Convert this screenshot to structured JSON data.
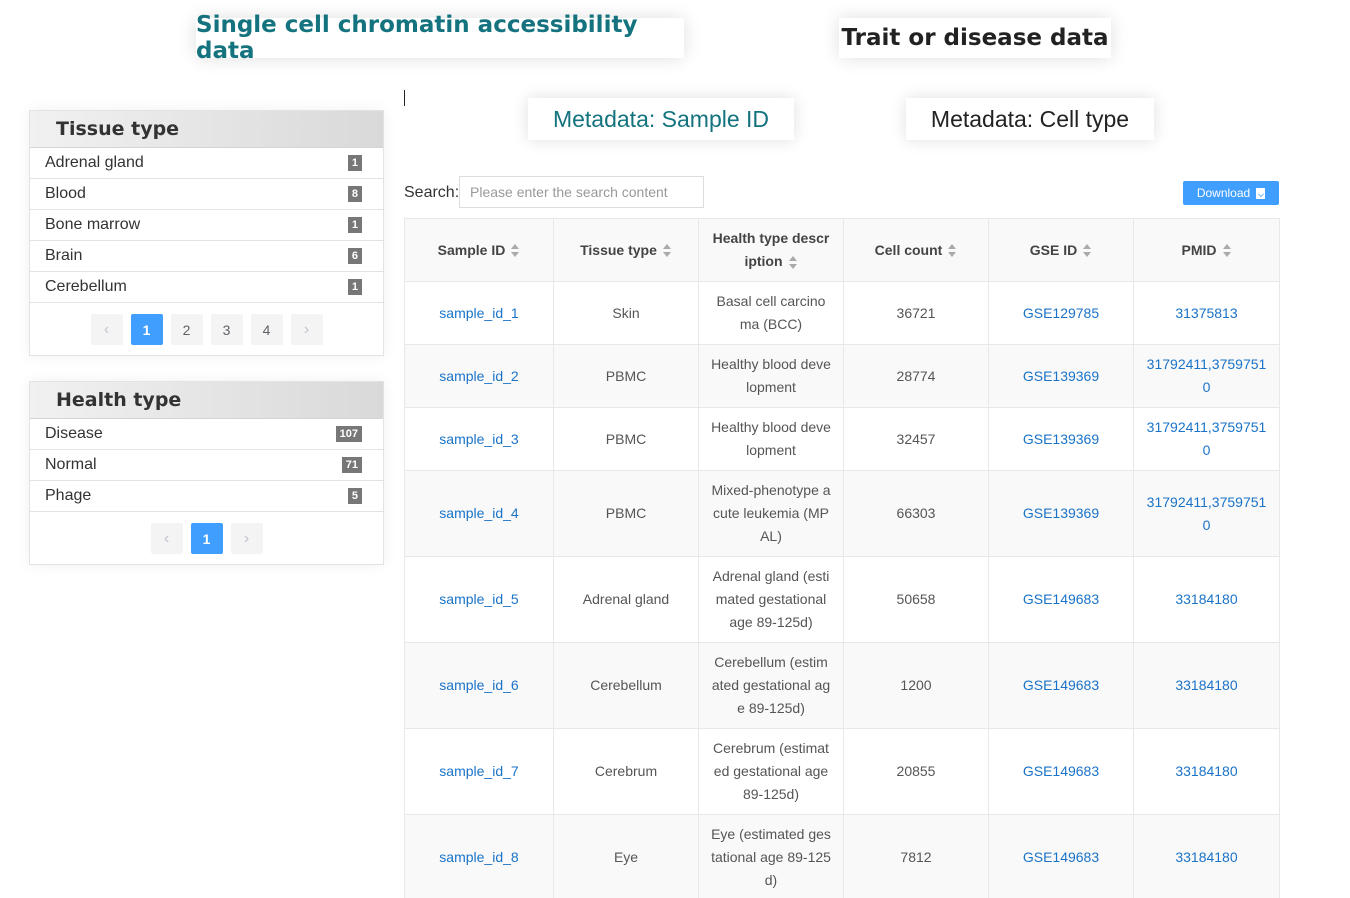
{
  "top_tabs": {
    "scca": "Single cell chromatin accessibility data",
    "trait": "Trait or disease data"
  },
  "meta_tabs": {
    "sample": "Metadata: Sample ID",
    "cell": "Metadata: Cell type"
  },
  "tissue_panel": {
    "title": "Tissue type",
    "items": [
      {
        "label": "Adrenal gland",
        "count": "1"
      },
      {
        "label": "Blood",
        "count": "8"
      },
      {
        "label": "Bone marrow",
        "count": "1"
      },
      {
        "label": "Brain",
        "count": "6"
      },
      {
        "label": "Cerebellum",
        "count": "1"
      }
    ],
    "pages": [
      "1",
      "2",
      "3",
      "4"
    ],
    "prev": "‹",
    "next": "›"
  },
  "health_panel": {
    "title": "Health type",
    "items": [
      {
        "label": "Disease",
        "count": "107"
      },
      {
        "label": "Normal",
        "count": "71"
      },
      {
        "label": "Phage",
        "count": "5"
      }
    ],
    "pages": [
      "1"
    ],
    "prev": "‹",
    "next": "›"
  },
  "search": {
    "label": "Search:",
    "placeholder": "Please enter the search content",
    "value": ""
  },
  "download_label": "Download",
  "table": {
    "headers": [
      "Sample ID",
      "Tissue type",
      "Health type description",
      "Cell count",
      "GSE ID",
      "PMID"
    ],
    "rows": [
      [
        "sample_id_1",
        "Skin",
        "Basal cell carcinoma (BCC)",
        "36721",
        "GSE129785",
        "31375813"
      ],
      [
        "sample_id_2",
        "PBMC",
        "Healthy blood development",
        "28774",
        "GSE139369",
        "31792411,37597510"
      ],
      [
        "sample_id_3",
        "PBMC",
        "Healthy blood development",
        "32457",
        "GSE139369",
        "31792411,37597510"
      ],
      [
        "sample_id_4",
        "PBMC",
        "Mixed-phenotype acute leukemia (MPAL)",
        "66303",
        "GSE139369",
        "31792411,37597510"
      ],
      [
        "sample_id_5",
        "Adrenal gland",
        "Adrenal gland (estimated gestational age 89-125d)",
        "50658",
        "GSE149683",
        "33184180"
      ],
      [
        "sample_id_6",
        "Cerebellum",
        "Cerebellum (estimated gestational age 89-125d)",
        "1200",
        "GSE149683",
        "33184180"
      ],
      [
        "sample_id_7",
        "Cerebrum",
        "Cerebrum (estimated gestational age 89-125d)",
        "20855",
        "GSE149683",
        "33184180"
      ],
      [
        "sample_id_8",
        "Eye",
        "Eye (estimated gestational age 89-125d)",
        "7812",
        "GSE149683",
        "33184180"
      ]
    ]
  }
}
